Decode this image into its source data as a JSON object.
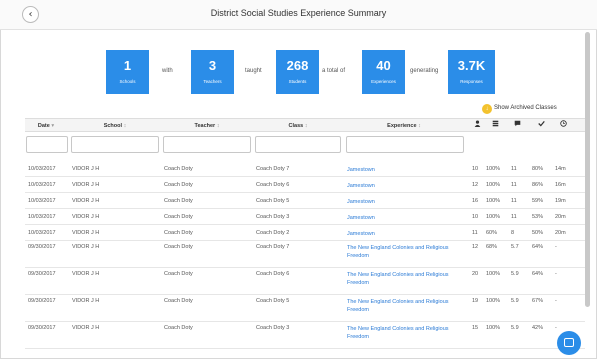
{
  "window": {
    "title": "District Social Studies Experience Summary"
  },
  "stats": [
    {
      "value": "1",
      "label": "Schools"
    },
    {
      "value": "3",
      "label": "Teachers"
    },
    {
      "value": "268",
      "label": "Students"
    },
    {
      "value": "40",
      "label": "Experiences"
    },
    {
      "value": "3.7K",
      "label": "Responses"
    }
  ],
  "connectors": [
    "with",
    "taught",
    "a total of",
    "generating"
  ],
  "archived_toggle": {
    "label": "Show Archived Classes"
  },
  "table": {
    "columns": [
      {
        "label": "Date",
        "sort": "▾"
      },
      {
        "label": "School",
        "sort": "↕"
      },
      {
        "label": "Teacher",
        "sort": "↕"
      },
      {
        "label": "Class",
        "sort": "↕"
      },
      {
        "label": "Experience",
        "sort": "↕"
      }
    ],
    "icon_columns": [
      "person-icon",
      "list-icon",
      "comment-icon",
      "check-icon",
      "clock-icon"
    ],
    "rows": [
      {
        "date": "10/03/2017",
        "school": "VIDOR J H",
        "teacher": "Coach Doty",
        "class": "Coach Doty 7",
        "experience": "Jamestown",
        "n": "10",
        "pct": "100%",
        "c": "11",
        "chk": "80%",
        "time": "14m"
      },
      {
        "date": "10/03/2017",
        "school": "VIDOR J H",
        "teacher": "Coach Doty",
        "class": "Coach Doty 6",
        "experience": "Jamestown",
        "n": "12",
        "pct": "100%",
        "c": "11",
        "chk": "86%",
        "time": "16m"
      },
      {
        "date": "10/03/2017",
        "school": "VIDOR J H",
        "teacher": "Coach Doty",
        "class": "Coach Doty 5",
        "experience": "Jamestown",
        "n": "16",
        "pct": "100%",
        "c": "11",
        "chk": "59%",
        "time": "19m"
      },
      {
        "date": "10/03/2017",
        "school": "VIDOR J H",
        "teacher": "Coach Doty",
        "class": "Coach Doty 3",
        "experience": "Jamestown",
        "n": "10",
        "pct": "100%",
        "c": "11",
        "chk": "53%",
        "time": "20m"
      },
      {
        "date": "10/03/2017",
        "school": "VIDOR J H",
        "teacher": "Coach Doty",
        "class": "Coach Doty 2",
        "experience": "Jamestown",
        "n": "11",
        "pct": "60%",
        "c": "8",
        "chk": "50%",
        "time": "20m"
      },
      {
        "date": "09/30/2017",
        "school": "VIDOR J H",
        "teacher": "Coach Doty",
        "class": "Coach Doty 7",
        "experience": "The New England Colonies and Religious Freedom",
        "n": "12",
        "pct": "68%",
        "c": "5.7",
        "chk": "64%",
        "time": "-"
      },
      {
        "date": "09/30/2017",
        "school": "VIDOR J H",
        "teacher": "Coach Doty",
        "class": "Coach Doty 6",
        "experience": "The New England Colonies and Religious Freedom",
        "n": "20",
        "pct": "100%",
        "c": "5.9",
        "chk": "64%",
        "time": "-"
      },
      {
        "date": "09/30/2017",
        "school": "VIDOR J H",
        "teacher": "Coach Doty",
        "class": "Coach Doty 5",
        "experience": "The New England Colonies and Religious Freedom",
        "n": "19",
        "pct": "100%",
        "c": "5.9",
        "chk": "67%",
        "time": "-"
      },
      {
        "date": "09/30/2017",
        "school": "VIDOR J H",
        "teacher": "Coach Doty",
        "class": "Coach Doty 3",
        "experience": "The New England Colonies and Religious Freedom",
        "n": "15",
        "pct": "100%",
        "c": "5.9",
        "chk": "42%",
        "time": "-"
      }
    ]
  }
}
